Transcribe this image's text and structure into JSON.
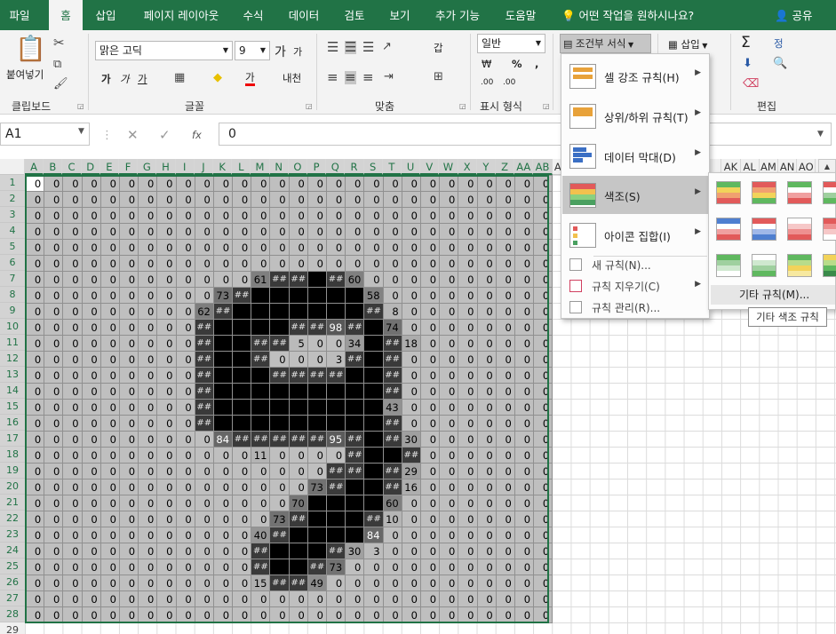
{
  "tabs": [
    "파일",
    "홈",
    "삽입",
    "페이지 레이아웃",
    "수식",
    "데이터",
    "검토",
    "보기",
    "추가 기능",
    "도움말"
  ],
  "tell_me": "어떤 작업을 원하시나요?",
  "share": "공유",
  "ribbon": {
    "paste": "붙여넣기",
    "font_name": "맑은 고딕",
    "font_size": "9",
    "number_format": "일반",
    "cf_button": "조건부 서식",
    "insert": "삽입",
    "group_labels": [
      "클립보드",
      "글꼴",
      "맞춤",
      "표시 형식",
      "편집"
    ],
    "increase_font": "가",
    "decrease_font": "가",
    "bold": "가",
    "italic": "가",
    "underline": "가",
    "font_color": "가",
    "phonetic": "내천",
    "wrap": "갑",
    "percent": "%",
    "comma": ",",
    "currency": "₩",
    "dec_inc": ".00",
    "dec_dec": ".00",
    "sum": "Σ",
    "sort": "정"
  },
  "formula_bar": {
    "name_box": "A1",
    "value": "0",
    "fx": "fx"
  },
  "columns": [
    "A",
    "B",
    "C",
    "D",
    "E",
    "F",
    "G",
    "H",
    "I",
    "J",
    "K",
    "L",
    "M",
    "N",
    "O",
    "P",
    "Q",
    "R",
    "S",
    "T",
    "U",
    "V",
    "W",
    "X",
    "Y",
    "Z",
    "AA",
    "AB",
    "AC",
    "",
    "",
    "",
    "",
    "",
    "",
    "",
    "",
    "AK",
    "AL",
    "AM",
    "AN",
    "AO",
    "AP",
    "A"
  ],
  "rows": [
    "1",
    "2",
    "3",
    "4",
    "5",
    "6",
    "7",
    "8",
    "9",
    "10",
    "11",
    "12",
    "13",
    "14",
    "15",
    "16",
    "17",
    "18",
    "19",
    "20",
    "21",
    "22",
    "23",
    "24",
    "25",
    "26",
    "27",
    "28",
    "29"
  ],
  "sheet": [
    [
      "0",
      "0",
      "0",
      "0",
      "0",
      "0",
      "0",
      "0",
      "0",
      "0",
      "0",
      "0",
      "0",
      "0",
      "0",
      "0",
      "0",
      "0",
      "0",
      "0",
      "0",
      "0",
      "0",
      "0",
      "0",
      "0",
      "0",
      "0"
    ],
    [
      "0",
      "0",
      "0",
      "0",
      "0",
      "0",
      "0",
      "0",
      "0",
      "0",
      "0",
      "0",
      "0",
      "0",
      "0",
      "0",
      "0",
      "0",
      "0",
      "0",
      "0",
      "0",
      "0",
      "0",
      "0",
      "0",
      "0",
      "0"
    ],
    [
      "0",
      "0",
      "0",
      "0",
      "0",
      "0",
      "0",
      "0",
      "0",
      "0",
      "0",
      "0",
      "0",
      "0",
      "0",
      "0",
      "0",
      "0",
      "0",
      "0",
      "0",
      "0",
      "0",
      "0",
      "0",
      "0",
      "0",
      "0"
    ],
    [
      "0",
      "0",
      "0",
      "0",
      "0",
      "0",
      "0",
      "0",
      "0",
      "0",
      "0",
      "0",
      "0",
      "0",
      "0",
      "0",
      "0",
      "0",
      "0",
      "0",
      "0",
      "0",
      "0",
      "0",
      "0",
      "0",
      "0",
      "0"
    ],
    [
      "0",
      "0",
      "0",
      "0",
      "0",
      "0",
      "0",
      "0",
      "0",
      "0",
      "0",
      "0",
      "0",
      "0",
      "0",
      "0",
      "0",
      "0",
      "0",
      "0",
      "0",
      "0",
      "0",
      "0",
      "0",
      "0",
      "0",
      "0"
    ],
    [
      "0",
      "0",
      "0",
      "0",
      "0",
      "0",
      "0",
      "0",
      "0",
      "0",
      "0",
      "0",
      "0",
      "0",
      "0",
      "0",
      "0",
      "0",
      "0",
      "0",
      "0",
      "0",
      "0",
      "0",
      "0",
      "0",
      "0",
      "0"
    ],
    [
      "0",
      "0",
      "0",
      "0",
      "0",
      "0",
      "0",
      "0",
      "0",
      "0",
      "0",
      "0",
      "61",
      "##",
      "##",
      "",
      "##",
      "60",
      "0",
      "0",
      "0",
      "0",
      "0",
      "0",
      "0",
      "0",
      "0",
      "0"
    ],
    [
      "0",
      "0",
      "0",
      "0",
      "0",
      "0",
      "0",
      "0",
      "0",
      "0",
      "73",
      "##",
      "",
      "",
      "",
      "",
      "",
      "",
      "58",
      "0",
      "0",
      "0",
      "0",
      "0",
      "0",
      "0",
      "0",
      "0"
    ],
    [
      "0",
      "0",
      "0",
      "0",
      "0",
      "0",
      "0",
      "0",
      "0",
      "62",
      "##",
      "",
      "",
      "",
      "",
      "",
      "",
      "",
      "##",
      "8",
      "0",
      "0",
      "0",
      "0",
      "0",
      "0",
      "0",
      "0"
    ],
    [
      "0",
      "0",
      "0",
      "0",
      "0",
      "0",
      "0",
      "0",
      "0",
      "##",
      "",
      "",
      "",
      "",
      "##",
      "##",
      "98",
      "##",
      "",
      "74",
      "0",
      "0",
      "0",
      "0",
      "0",
      "0",
      "0",
      "0"
    ],
    [
      "0",
      "0",
      "0",
      "0",
      "0",
      "0",
      "0",
      "0",
      "0",
      "##",
      "",
      "",
      "##",
      "##",
      "5",
      "0",
      "0",
      "34",
      "",
      "##",
      "18",
      "0",
      "0",
      "0",
      "0",
      "0",
      "0",
      "0"
    ],
    [
      "0",
      "0",
      "0",
      "0",
      "0",
      "0",
      "0",
      "0",
      "0",
      "##",
      "",
      "",
      "##",
      "0",
      "0",
      "0",
      "3",
      "##",
      "",
      "##",
      "0",
      "0",
      "0",
      "0",
      "0",
      "0",
      "0",
      "0"
    ],
    [
      "0",
      "0",
      "0",
      "0",
      "0",
      "0",
      "0",
      "0",
      "0",
      "##",
      "",
      "",
      "",
      "##",
      "##",
      "##",
      "##",
      "",
      "",
      "##",
      "0",
      "0",
      "0",
      "0",
      "0",
      "0",
      "0",
      "0"
    ],
    [
      "0",
      "0",
      "0",
      "0",
      "0",
      "0",
      "0",
      "0",
      "0",
      "##",
      "",
      "",
      "",
      "",
      "",
      "",
      "",
      "",
      "",
      "##",
      "0",
      "0",
      "0",
      "0",
      "0",
      "0",
      "0",
      "0"
    ],
    [
      "0",
      "0",
      "0",
      "0",
      "0",
      "0",
      "0",
      "0",
      "0",
      "##",
      "",
      "",
      "",
      "",
      "",
      "",
      "",
      "",
      "",
      "43",
      "0",
      "0",
      "0",
      "0",
      "0",
      "0",
      "0",
      "0"
    ],
    [
      "0",
      "0",
      "0",
      "0",
      "0",
      "0",
      "0",
      "0",
      "0",
      "##",
      "",
      "",
      "",
      "",
      "",
      "",
      "",
      "",
      "",
      "##",
      "0",
      "0",
      "0",
      "0",
      "0",
      "0",
      "0",
      "0"
    ],
    [
      "0",
      "0",
      "0",
      "0",
      "0",
      "0",
      "0",
      "0",
      "0",
      "0",
      "84",
      "##",
      "##",
      "##",
      "##",
      "##",
      "95",
      "##",
      "",
      "##",
      "30",
      "0",
      "0",
      "0",
      "0",
      "0",
      "0",
      "0"
    ],
    [
      "0",
      "0",
      "0",
      "0",
      "0",
      "0",
      "0",
      "0",
      "0",
      "0",
      "0",
      "0",
      "11",
      "0",
      "0",
      "0",
      "0",
      "##",
      "",
      "",
      "##",
      "0",
      "0",
      "0",
      "0",
      "0",
      "0",
      "0"
    ],
    [
      "0",
      "0",
      "0",
      "0",
      "0",
      "0",
      "0",
      "0",
      "0",
      "0",
      "0",
      "0",
      "0",
      "0",
      "0",
      "0",
      "##",
      "##",
      "",
      "##",
      "29",
      "0",
      "0",
      "0",
      "0",
      "0",
      "0",
      "0"
    ],
    [
      "0",
      "0",
      "0",
      "0",
      "0",
      "0",
      "0",
      "0",
      "0",
      "0",
      "0",
      "0",
      "0",
      "0",
      "0",
      "73",
      "##",
      "",
      "",
      "##",
      "16",
      "0",
      "0",
      "0",
      "0",
      "0",
      "0",
      "0"
    ],
    [
      "0",
      "0",
      "0",
      "0",
      "0",
      "0",
      "0",
      "0",
      "0",
      "0",
      "0",
      "0",
      "0",
      "0",
      "70",
      "",
      "",
      "",
      "",
      "60",
      "0",
      "0",
      "0",
      "0",
      "0",
      "0",
      "0",
      "0"
    ],
    [
      "0",
      "0",
      "0",
      "0",
      "0",
      "0",
      "0",
      "0",
      "0",
      "0",
      "0",
      "0",
      "0",
      "73",
      "##",
      "",
      "",
      "",
      "##",
      "10",
      "0",
      "0",
      "0",
      "0",
      "0",
      "0",
      "0",
      "0"
    ],
    [
      "0",
      "0",
      "0",
      "0",
      "0",
      "0",
      "0",
      "0",
      "0",
      "0",
      "0",
      "0",
      "40",
      "##",
      "",
      "",
      "",
      "",
      "84",
      "0",
      "0",
      "0",
      "0",
      "0",
      "0",
      "0",
      "0",
      "0"
    ],
    [
      "0",
      "0",
      "0",
      "0",
      "0",
      "0",
      "0",
      "0",
      "0",
      "0",
      "0",
      "0",
      "##",
      "",
      "",
      "",
      "##",
      "30",
      "3",
      "0",
      "0",
      "0",
      "0",
      "0",
      "0",
      "0",
      "0",
      "0"
    ],
    [
      "0",
      "0",
      "0",
      "0",
      "0",
      "0",
      "0",
      "0",
      "0",
      "0",
      "0",
      "0",
      "##",
      "",
      "",
      "##",
      "73",
      "0",
      "0",
      "0",
      "0",
      "0",
      "0",
      "0",
      "0",
      "0",
      "0",
      "0"
    ],
    [
      "0",
      "0",
      "0",
      "0",
      "0",
      "0",
      "0",
      "0",
      "0",
      "0",
      "0",
      "0",
      "15",
      "##",
      "##",
      "49",
      "0",
      "0",
      "0",
      "0",
      "0",
      "0",
      "0",
      "0",
      "0",
      "0",
      "0",
      "0"
    ],
    [
      "0",
      "0",
      "0",
      "0",
      "0",
      "0",
      "0",
      "0",
      "0",
      "0",
      "0",
      "0",
      "0",
      "0",
      "0",
      "0",
      "0",
      "0",
      "0",
      "0",
      "0",
      "0",
      "0",
      "0",
      "0",
      "0",
      "0",
      "0"
    ],
    [
      "0",
      "0",
      "0",
      "0",
      "0",
      "0",
      "0",
      "0",
      "0",
      "0",
      "0",
      "0",
      "0",
      "0",
      "0",
      "0",
      "0",
      "0",
      "0",
      "0",
      "0",
      "0",
      "0",
      "0",
      "0",
      "0",
      "0",
      "0"
    ]
  ],
  "cf_menu": {
    "items": [
      {
        "label": "셀 강조 규칙(H)",
        "icon": "highlight-cells-icon"
      },
      {
        "label": "상위/하위 규칙(T)",
        "icon": "top-bottom-icon"
      },
      {
        "label": "데이터 막대(D)",
        "icon": "data-bars-icon"
      },
      {
        "label": "색조(S)",
        "icon": "color-scales-icon"
      },
      {
        "label": "아이콘 집합(I)",
        "icon": "icon-sets-icon"
      }
    ],
    "subitems": [
      {
        "label": "새 규칙(N)...",
        "icon": "new-rule-icon"
      },
      {
        "label": "규칙 지우기(C)",
        "icon": "clear-rules-icon"
      },
      {
        "label": "규칙 관리(R)...",
        "icon": "manage-rules-icon"
      }
    ]
  },
  "color_scales": {
    "more": "기타 규칙(M)...",
    "tooltip": "기타 색조 규칙"
  }
}
